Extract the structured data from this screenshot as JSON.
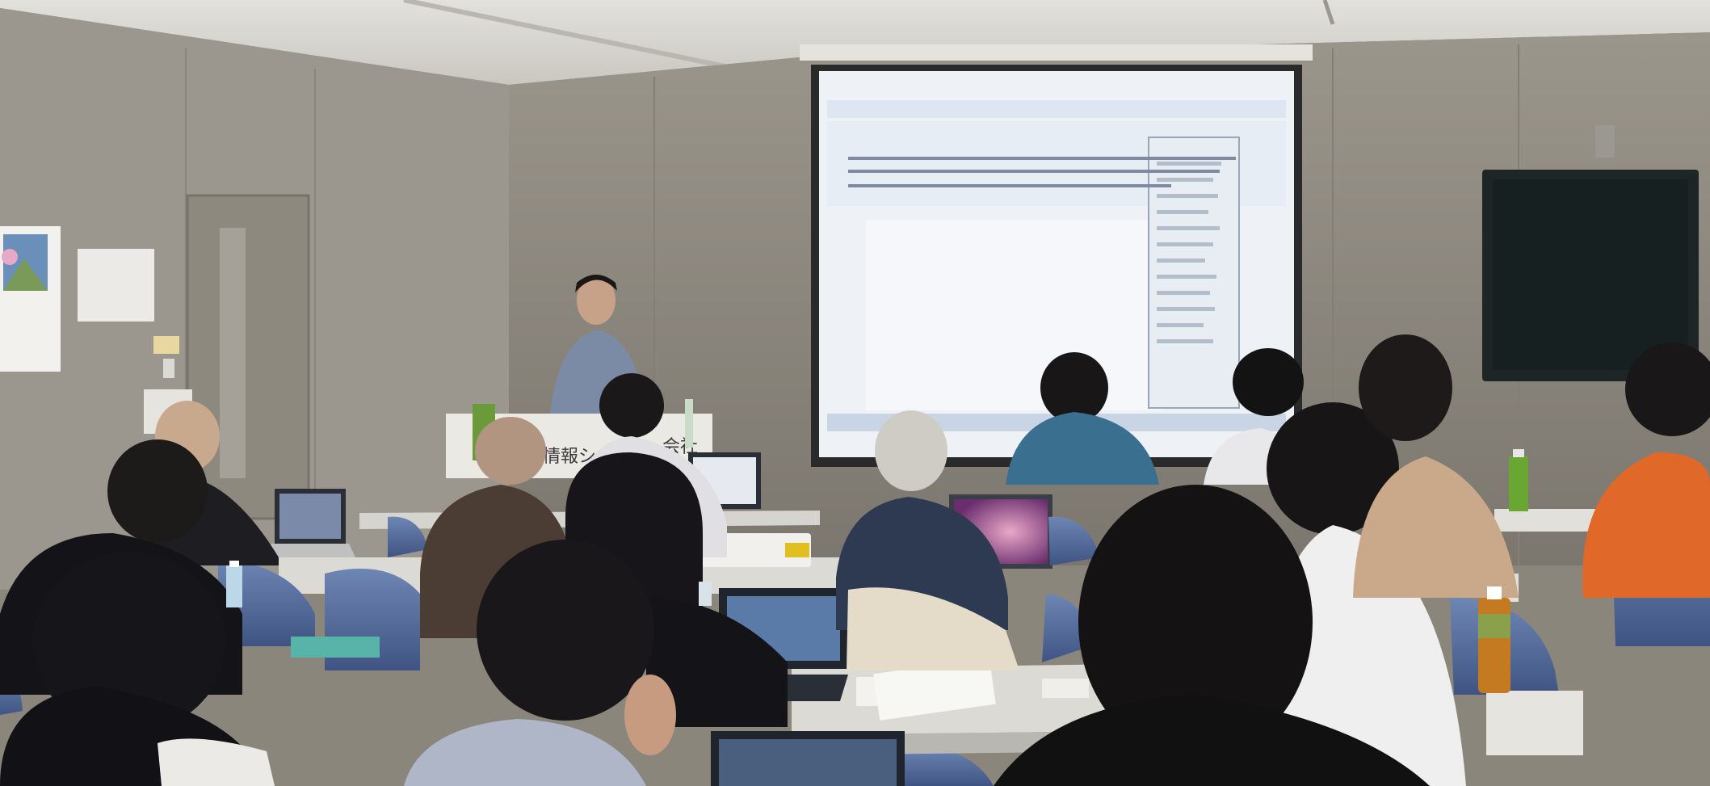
{
  "scene": {
    "podium_sign": "情報シ",
    "podium_sign_suffix": "会社",
    "colors": {
      "ceiling": "#d9d8d2",
      "wall": "#8f8a80",
      "screen": "#eef2f6",
      "monitor": "#1e2525",
      "table": "#dcdad4"
    }
  }
}
